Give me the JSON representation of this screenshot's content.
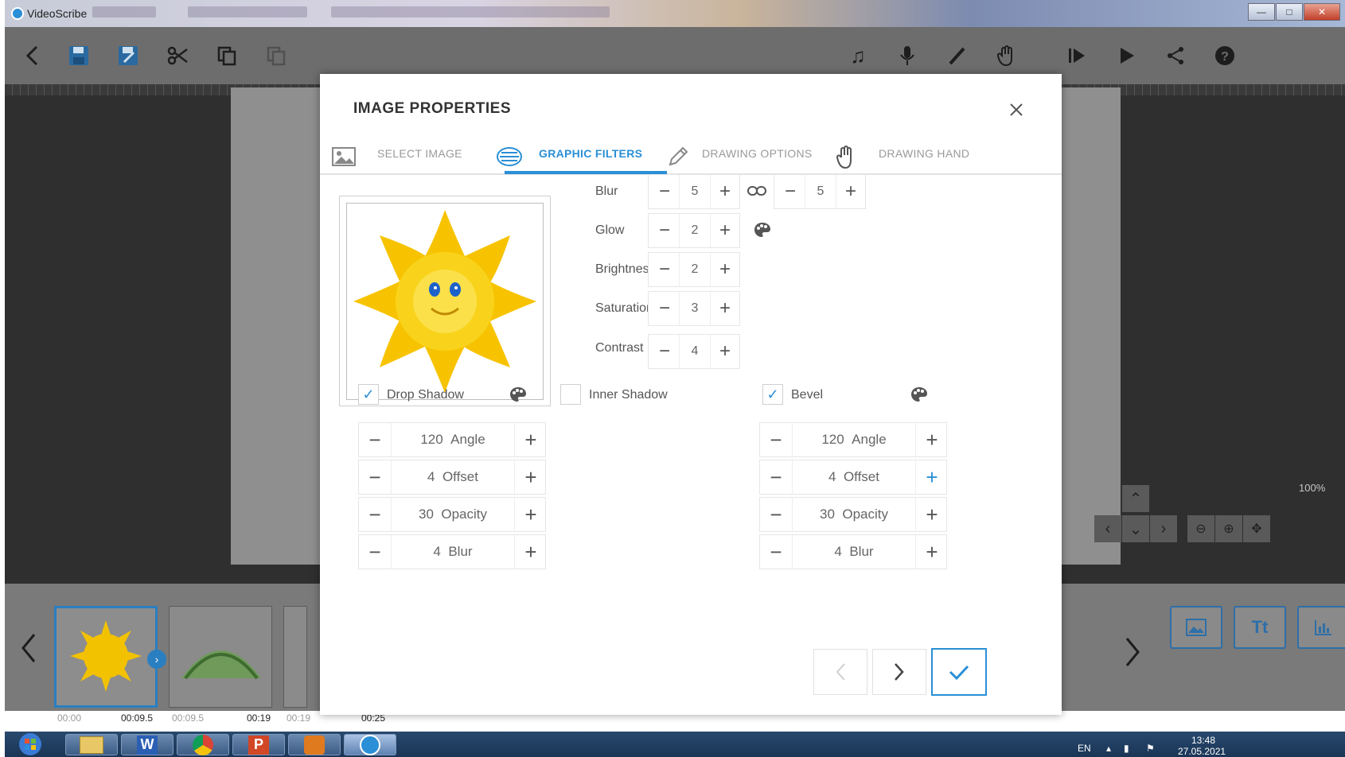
{
  "window": {
    "title": "VideoScribe",
    "controls": [
      "—",
      "□",
      "✕"
    ]
  },
  "toolbar": {
    "left_icons": [
      "back-icon",
      "save-icon",
      "save-as-icon",
      "cut-icon",
      "copy-icon",
      "paste-icon"
    ],
    "right_icons": [
      "music-icon",
      "microphone-icon",
      "pen-icon",
      "hand-icon",
      "preview-icon",
      "play-icon",
      "share-icon",
      "help-icon"
    ]
  },
  "workspace": {
    "zoom": "100%"
  },
  "filmstrip": {
    "thumbnails": [
      {
        "time": "00:09.5",
        "faint_time": "00:00",
        "selected": true
      },
      {
        "time": "00:19",
        "faint_time": "00:09.5",
        "selected": false
      },
      {
        "time": "00:25",
        "faint_time": "00:19",
        "selected": false
      }
    ],
    "tools": [
      "image-tool",
      "text-tool",
      "chart-tool"
    ],
    "text_tool_label": "Tt"
  },
  "taskbar": {
    "language": "EN",
    "time": "13:48",
    "date": "27.05.2021"
  },
  "dialog": {
    "title": "IMAGE PROPERTIES",
    "close_icon": "close-icon",
    "tabs": [
      {
        "label": "SELECT IMAGE",
        "icon": "image-icon",
        "active": false
      },
      {
        "label": "GRAPHIC FILTERS",
        "icon": "filters-icon",
        "active": true
      },
      {
        "label": "DRAWING OPTIONS",
        "icon": "pencil-icon",
        "active": false
      },
      {
        "label": "DRAWING HAND",
        "icon": "hand-icon",
        "active": false
      }
    ],
    "filters": {
      "blur": {
        "label": "Blur",
        "x": "5",
        "y": "5",
        "linked": true
      },
      "glow": {
        "label": "Glow",
        "value": "2"
      },
      "brightness": {
        "label": "Brightness",
        "value": "2"
      },
      "saturation": {
        "label": "Saturation",
        "value": "3"
      },
      "contrast": {
        "label": "Contrast",
        "value": "4"
      }
    },
    "drop_shadow": {
      "label": "Drop Shadow",
      "checked": true,
      "angle": "120",
      "angle_label": "Angle",
      "offset": "4",
      "offset_label": "Offset",
      "opacity": "30",
      "opacity_label": "Opacity",
      "blur": "4",
      "blur_label": "Blur"
    },
    "inner_shadow": {
      "label": "Inner Shadow",
      "checked": false
    },
    "bevel": {
      "label": "Bevel",
      "checked": true,
      "angle": "120",
      "angle_label": "Angle",
      "offset": "4",
      "offset_label": "Offset",
      "opacity": "30",
      "opacity_label": "Opacity",
      "blur": "4",
      "blur_label": "Blur"
    },
    "accent_color": "#2a8fd6"
  }
}
